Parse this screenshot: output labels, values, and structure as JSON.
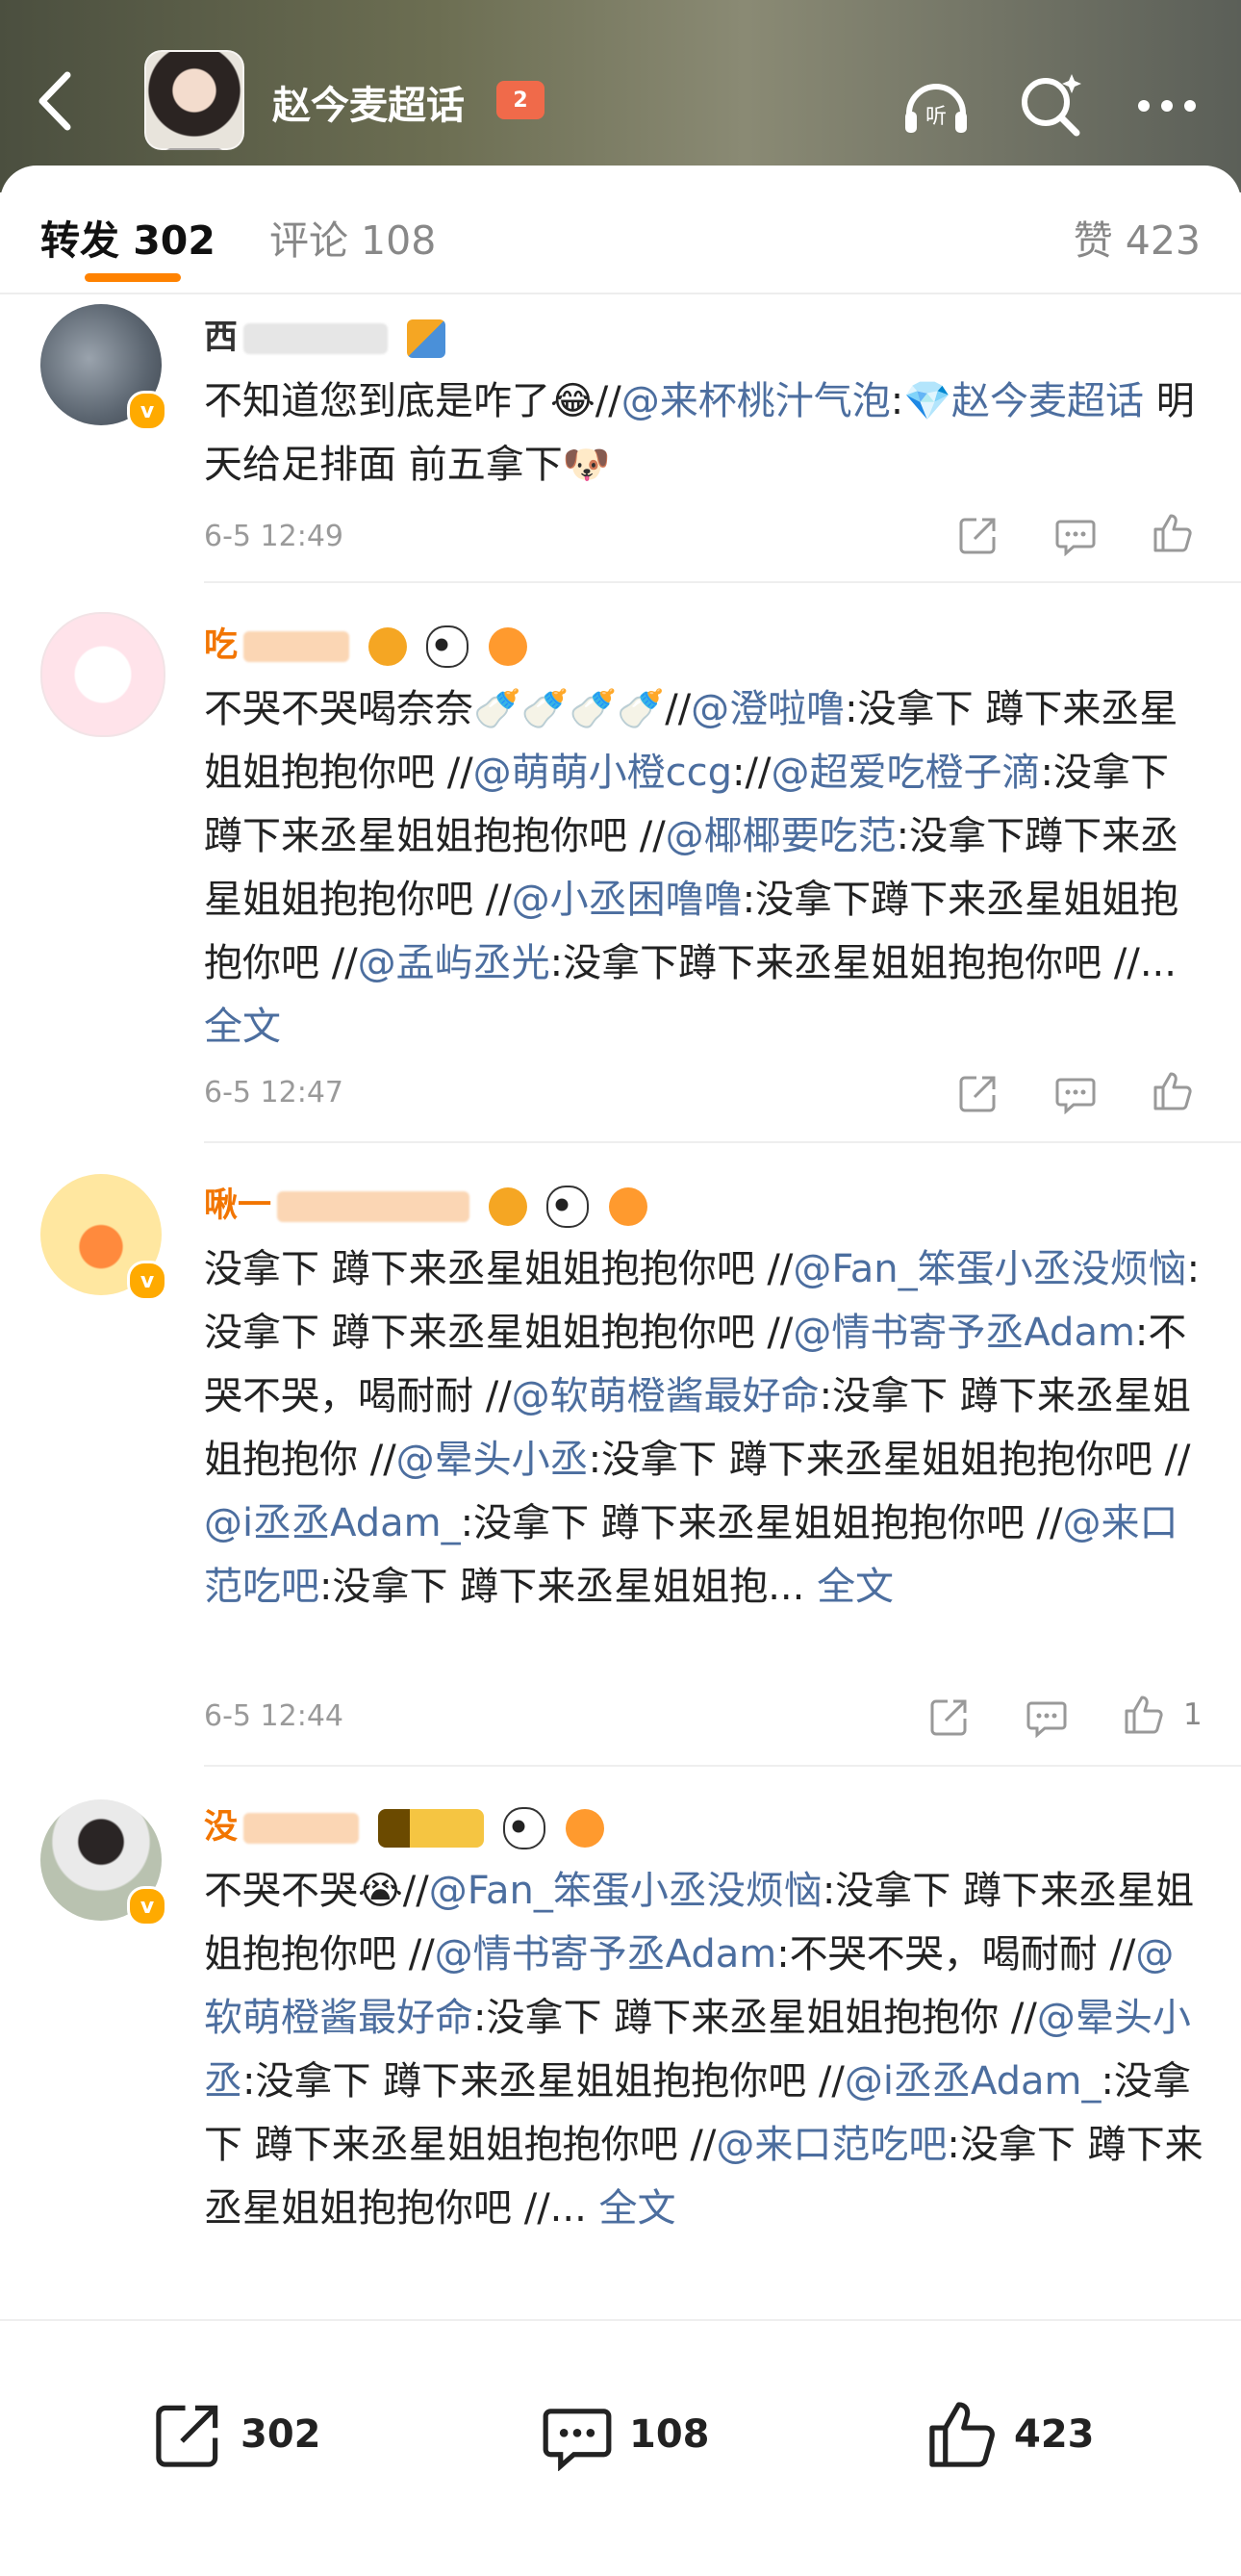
{
  "header": {
    "title": "赵今麦超话",
    "level_badge": "2",
    "icons": [
      "back-icon",
      "listen-icon",
      "search-icon",
      "more-icon"
    ]
  },
  "tabs": {
    "repost_label": "转发 302",
    "comment_label": "评论 108",
    "like_label": "赞 423"
  },
  "posts": [
    {
      "username": "西",
      "time": "6-5 12:49",
      "content": [
        {
          "t": "不知道您到底是咋了😂//"
        },
        {
          "t": "@来杯桃汁气泡",
          "at": true
        },
        {
          "t": ":"
        },
        {
          "t": "💎赵今麦超话",
          "at": true
        },
        {
          "t": " 明天给足排面 前五拿下🐶"
        }
      ]
    },
    {
      "username": "吃",
      "time": "6-5 12:47",
      "content": [
        {
          "t": "不哭不哭喝奈奈🍼🍼🍼🍼//"
        },
        {
          "t": "@澄啦噜",
          "at": true
        },
        {
          "t": ":没拿下 蹲下来丞星姐姐抱抱你吧 //"
        },
        {
          "t": "@萌萌小橙ccg",
          "at": true
        },
        {
          "t": "://"
        },
        {
          "t": "@超爱吃橙子滴",
          "at": true
        },
        {
          "t": ":没拿下 蹲下来丞星姐姐抱抱你吧 //"
        },
        {
          "t": "@椰椰要吃范",
          "at": true
        },
        {
          "t": ":没拿下蹲下来丞星姐姐抱抱你吧 //"
        },
        {
          "t": "@小丞困噜噜",
          "at": true
        },
        {
          "t": ":没拿下蹲下来丞星姐姐抱抱你吧 //"
        },
        {
          "t": "@孟屿丞光",
          "at": true
        },
        {
          "t": ":没拿下蹲下来丞星姐姐抱抱你吧 //... "
        },
        {
          "t": "全文",
          "full": true
        }
      ]
    },
    {
      "username": "啾一",
      "time": "6-5 12:44",
      "like_count": "1",
      "content": [
        {
          "t": "没拿下 蹲下来丞星姐姐抱抱你吧 //"
        },
        {
          "t": "@Fan_笨蛋小丞没烦恼",
          "at": true
        },
        {
          "t": ":没拿下 蹲下来丞星姐姐抱抱你吧 //"
        },
        {
          "t": "@情书寄予丞Adam",
          "at": true
        },
        {
          "t": ":不哭不哭，喝耐耐 //"
        },
        {
          "t": "@软萌橙酱最好命",
          "at": true
        },
        {
          "t": ":没拿下 蹲下来丞星姐姐抱抱你 //"
        },
        {
          "t": "@晕头小丞",
          "at": true
        },
        {
          "t": ":没拿下 蹲下来丞星姐姐抱抱你吧 //"
        },
        {
          "t": "@i丞丞Adam_",
          "at": true
        },
        {
          "t": ":没拿下 蹲下来丞星姐姐抱抱你吧 //"
        },
        {
          "t": "@来口范吃吧",
          "at": true
        },
        {
          "t": ":没拿下 蹲下来丞星姐姐抱... "
        },
        {
          "t": "全文",
          "full": true
        }
      ]
    },
    {
      "username": "没",
      "content": [
        {
          "t": "不哭不哭😭//"
        },
        {
          "t": "@Fan_笨蛋小丞没烦恼",
          "at": true
        },
        {
          "t": ":没拿下 蹲下来丞星姐姐抱抱你吧 //"
        },
        {
          "t": "@情书寄予丞Adam",
          "at": true
        },
        {
          "t": ":不哭不哭，喝耐耐 //"
        },
        {
          "t": "@软萌橙酱最好命",
          "at": true
        },
        {
          "t": ":没拿下 蹲下来丞星姐姐抱抱你 //"
        },
        {
          "t": "@晕头小丞",
          "at": true
        },
        {
          "t": ":没拿下 蹲下来丞星姐姐抱抱你吧 //"
        },
        {
          "t": "@i丞丞Adam_",
          "at": true
        },
        {
          "t": ":没拿下 蹲下来丞星姐姐抱抱你吧 //"
        },
        {
          "t": "@来口范吃吧",
          "at": true
        },
        {
          "t": ":没拿下 蹲下来丞星姐姐抱抱你吧 //... "
        },
        {
          "t": "全文",
          "full": true
        }
      ]
    }
  ],
  "bottom_bar": {
    "repost_count": "302",
    "comment_count": "108",
    "like_count": "423"
  },
  "colors": {
    "accent": "#ff8200",
    "mention": "#4c6e9f",
    "username": "#f27500"
  }
}
